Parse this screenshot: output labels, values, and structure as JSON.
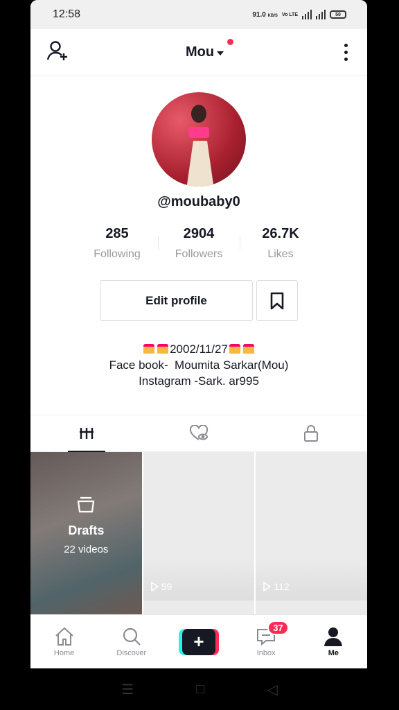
{
  "status_bar": {
    "time": "12:58",
    "speed": "91.0",
    "speed_unit": "KB/S",
    "network": "Vo LTE",
    "battery": "50"
  },
  "header": {
    "title": "Mou"
  },
  "profile": {
    "username": "@moubaby0",
    "stats": [
      {
        "value": "285",
        "label": "Following"
      },
      {
        "value": "2904",
        "label": "Followers"
      },
      {
        "value": "26.7K",
        "label": "Likes"
      }
    ],
    "edit_label": "Edit profile",
    "bio_line1": "2002/11/27",
    "bio_line2": "Face book-  Moumita Sarkar(Mou)",
    "bio_line3": "Instagram -Sark. ar995"
  },
  "grid": {
    "drafts_title": "Drafts",
    "drafts_count": "22 videos",
    "video1_views": "59",
    "video2_views": "112"
  },
  "bottom_nav": {
    "home": "Home",
    "discover": "Discover",
    "inbox": "Inbox",
    "inbox_badge": "37",
    "me": "Me"
  },
  "colors": {
    "accent": "#fe2c55",
    "cyan": "#25f4ee",
    "text": "#161823",
    "muted": "#999999"
  }
}
